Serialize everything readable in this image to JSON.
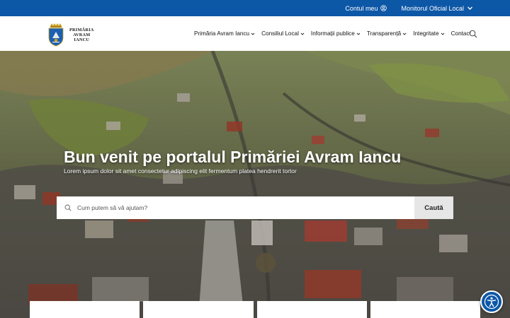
{
  "topbar": {
    "account_label": "Contul meu",
    "monitor_label": "Monitorul Oficial Local"
  },
  "logo": {
    "line1": "PRIMĂRIA",
    "line2": "AVRAM",
    "line3": "IANCU"
  },
  "nav": {
    "items": [
      {
        "label": "Primăria Avram Iancu",
        "has_dropdown": true
      },
      {
        "label": "Consiliul Local",
        "has_dropdown": true
      },
      {
        "label": "Informații publice",
        "has_dropdown": true
      },
      {
        "label": "Transparență",
        "has_dropdown": true
      },
      {
        "label": "Integritate",
        "has_dropdown": true
      },
      {
        "label": "Contact",
        "has_dropdown": false
      }
    ]
  },
  "hero": {
    "title": "Bun venit pe portalul Primăriei Avram Iancu",
    "subtitle": "Lorem ipsum dolor sit amet consectetur adipiscing elit fermentum platea hendrerit tortor"
  },
  "search": {
    "placeholder": "Cum putem să vă ajutam?",
    "button_label": "Caută"
  },
  "colors": {
    "brand_blue": "#0d57a7",
    "search_button_bg": "#e6e6e6"
  },
  "icons": {
    "account": "user-circle-icon",
    "search": "search-icon",
    "accessibility": "accessibility-icon"
  }
}
